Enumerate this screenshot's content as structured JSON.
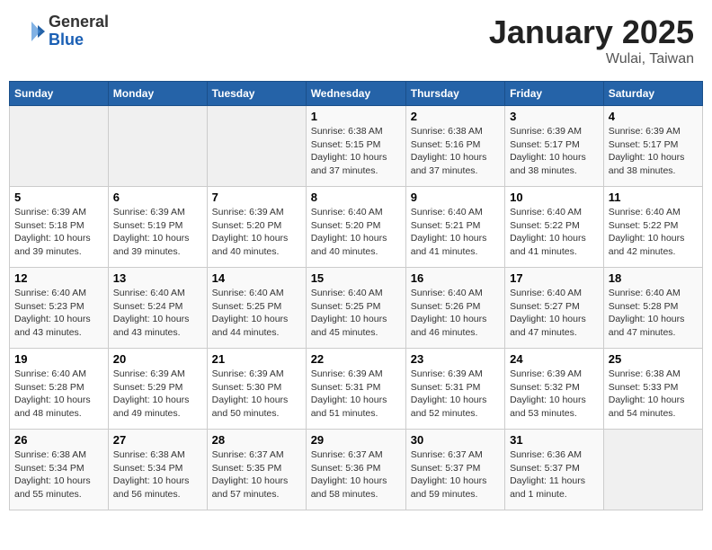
{
  "header": {
    "logo_general": "General",
    "logo_blue": "Blue",
    "title": "January 2025",
    "subtitle": "Wulai, Taiwan"
  },
  "weekdays": [
    "Sunday",
    "Monday",
    "Tuesday",
    "Wednesday",
    "Thursday",
    "Friday",
    "Saturday"
  ],
  "weeks": [
    [
      {
        "day": "",
        "empty": true
      },
      {
        "day": "",
        "empty": true
      },
      {
        "day": "",
        "empty": true
      },
      {
        "day": "1",
        "sunrise": "6:38 AM",
        "sunset": "5:15 PM",
        "daylight": "10 hours and 37 minutes."
      },
      {
        "day": "2",
        "sunrise": "6:38 AM",
        "sunset": "5:16 PM",
        "daylight": "10 hours and 37 minutes."
      },
      {
        "day": "3",
        "sunrise": "6:39 AM",
        "sunset": "5:17 PM",
        "daylight": "10 hours and 38 minutes."
      },
      {
        "day": "4",
        "sunrise": "6:39 AM",
        "sunset": "5:17 PM",
        "daylight": "10 hours and 38 minutes."
      }
    ],
    [
      {
        "day": "5",
        "sunrise": "6:39 AM",
        "sunset": "5:18 PM",
        "daylight": "10 hours and 39 minutes."
      },
      {
        "day": "6",
        "sunrise": "6:39 AM",
        "sunset": "5:19 PM",
        "daylight": "10 hours and 39 minutes."
      },
      {
        "day": "7",
        "sunrise": "6:39 AM",
        "sunset": "5:20 PM",
        "daylight": "10 hours and 40 minutes."
      },
      {
        "day": "8",
        "sunrise": "6:40 AM",
        "sunset": "5:20 PM",
        "daylight": "10 hours and 40 minutes."
      },
      {
        "day": "9",
        "sunrise": "6:40 AM",
        "sunset": "5:21 PM",
        "daylight": "10 hours and 41 minutes."
      },
      {
        "day": "10",
        "sunrise": "6:40 AM",
        "sunset": "5:22 PM",
        "daylight": "10 hours and 41 minutes."
      },
      {
        "day": "11",
        "sunrise": "6:40 AM",
        "sunset": "5:22 PM",
        "daylight": "10 hours and 42 minutes."
      }
    ],
    [
      {
        "day": "12",
        "sunrise": "6:40 AM",
        "sunset": "5:23 PM",
        "daylight": "10 hours and 43 minutes."
      },
      {
        "day": "13",
        "sunrise": "6:40 AM",
        "sunset": "5:24 PM",
        "daylight": "10 hours and 43 minutes."
      },
      {
        "day": "14",
        "sunrise": "6:40 AM",
        "sunset": "5:25 PM",
        "daylight": "10 hours and 44 minutes."
      },
      {
        "day": "15",
        "sunrise": "6:40 AM",
        "sunset": "5:25 PM",
        "daylight": "10 hours and 45 minutes."
      },
      {
        "day": "16",
        "sunrise": "6:40 AM",
        "sunset": "5:26 PM",
        "daylight": "10 hours and 46 minutes."
      },
      {
        "day": "17",
        "sunrise": "6:40 AM",
        "sunset": "5:27 PM",
        "daylight": "10 hours and 47 minutes."
      },
      {
        "day": "18",
        "sunrise": "6:40 AM",
        "sunset": "5:28 PM",
        "daylight": "10 hours and 47 minutes."
      }
    ],
    [
      {
        "day": "19",
        "sunrise": "6:40 AM",
        "sunset": "5:28 PM",
        "daylight": "10 hours and 48 minutes."
      },
      {
        "day": "20",
        "sunrise": "6:39 AM",
        "sunset": "5:29 PM",
        "daylight": "10 hours and 49 minutes."
      },
      {
        "day": "21",
        "sunrise": "6:39 AM",
        "sunset": "5:30 PM",
        "daylight": "10 hours and 50 minutes."
      },
      {
        "day": "22",
        "sunrise": "6:39 AM",
        "sunset": "5:31 PM",
        "daylight": "10 hours and 51 minutes."
      },
      {
        "day": "23",
        "sunrise": "6:39 AM",
        "sunset": "5:31 PM",
        "daylight": "10 hours and 52 minutes."
      },
      {
        "day": "24",
        "sunrise": "6:39 AM",
        "sunset": "5:32 PM",
        "daylight": "10 hours and 53 minutes."
      },
      {
        "day": "25",
        "sunrise": "6:38 AM",
        "sunset": "5:33 PM",
        "daylight": "10 hours and 54 minutes."
      }
    ],
    [
      {
        "day": "26",
        "sunrise": "6:38 AM",
        "sunset": "5:34 PM",
        "daylight": "10 hours and 55 minutes."
      },
      {
        "day": "27",
        "sunrise": "6:38 AM",
        "sunset": "5:34 PM",
        "daylight": "10 hours and 56 minutes."
      },
      {
        "day": "28",
        "sunrise": "6:37 AM",
        "sunset": "5:35 PM",
        "daylight": "10 hours and 57 minutes."
      },
      {
        "day": "29",
        "sunrise": "6:37 AM",
        "sunset": "5:36 PM",
        "daylight": "10 hours and 58 minutes."
      },
      {
        "day": "30",
        "sunrise": "6:37 AM",
        "sunset": "5:37 PM",
        "daylight": "10 hours and 59 minutes."
      },
      {
        "day": "31",
        "sunrise": "6:36 AM",
        "sunset": "5:37 PM",
        "daylight": "11 hours and 1 minute."
      },
      {
        "day": "",
        "empty": true
      }
    ]
  ],
  "labels": {
    "sunrise_prefix": "Sunrise: ",
    "sunset_prefix": "Sunset: ",
    "daylight_prefix": "Daylight: "
  }
}
